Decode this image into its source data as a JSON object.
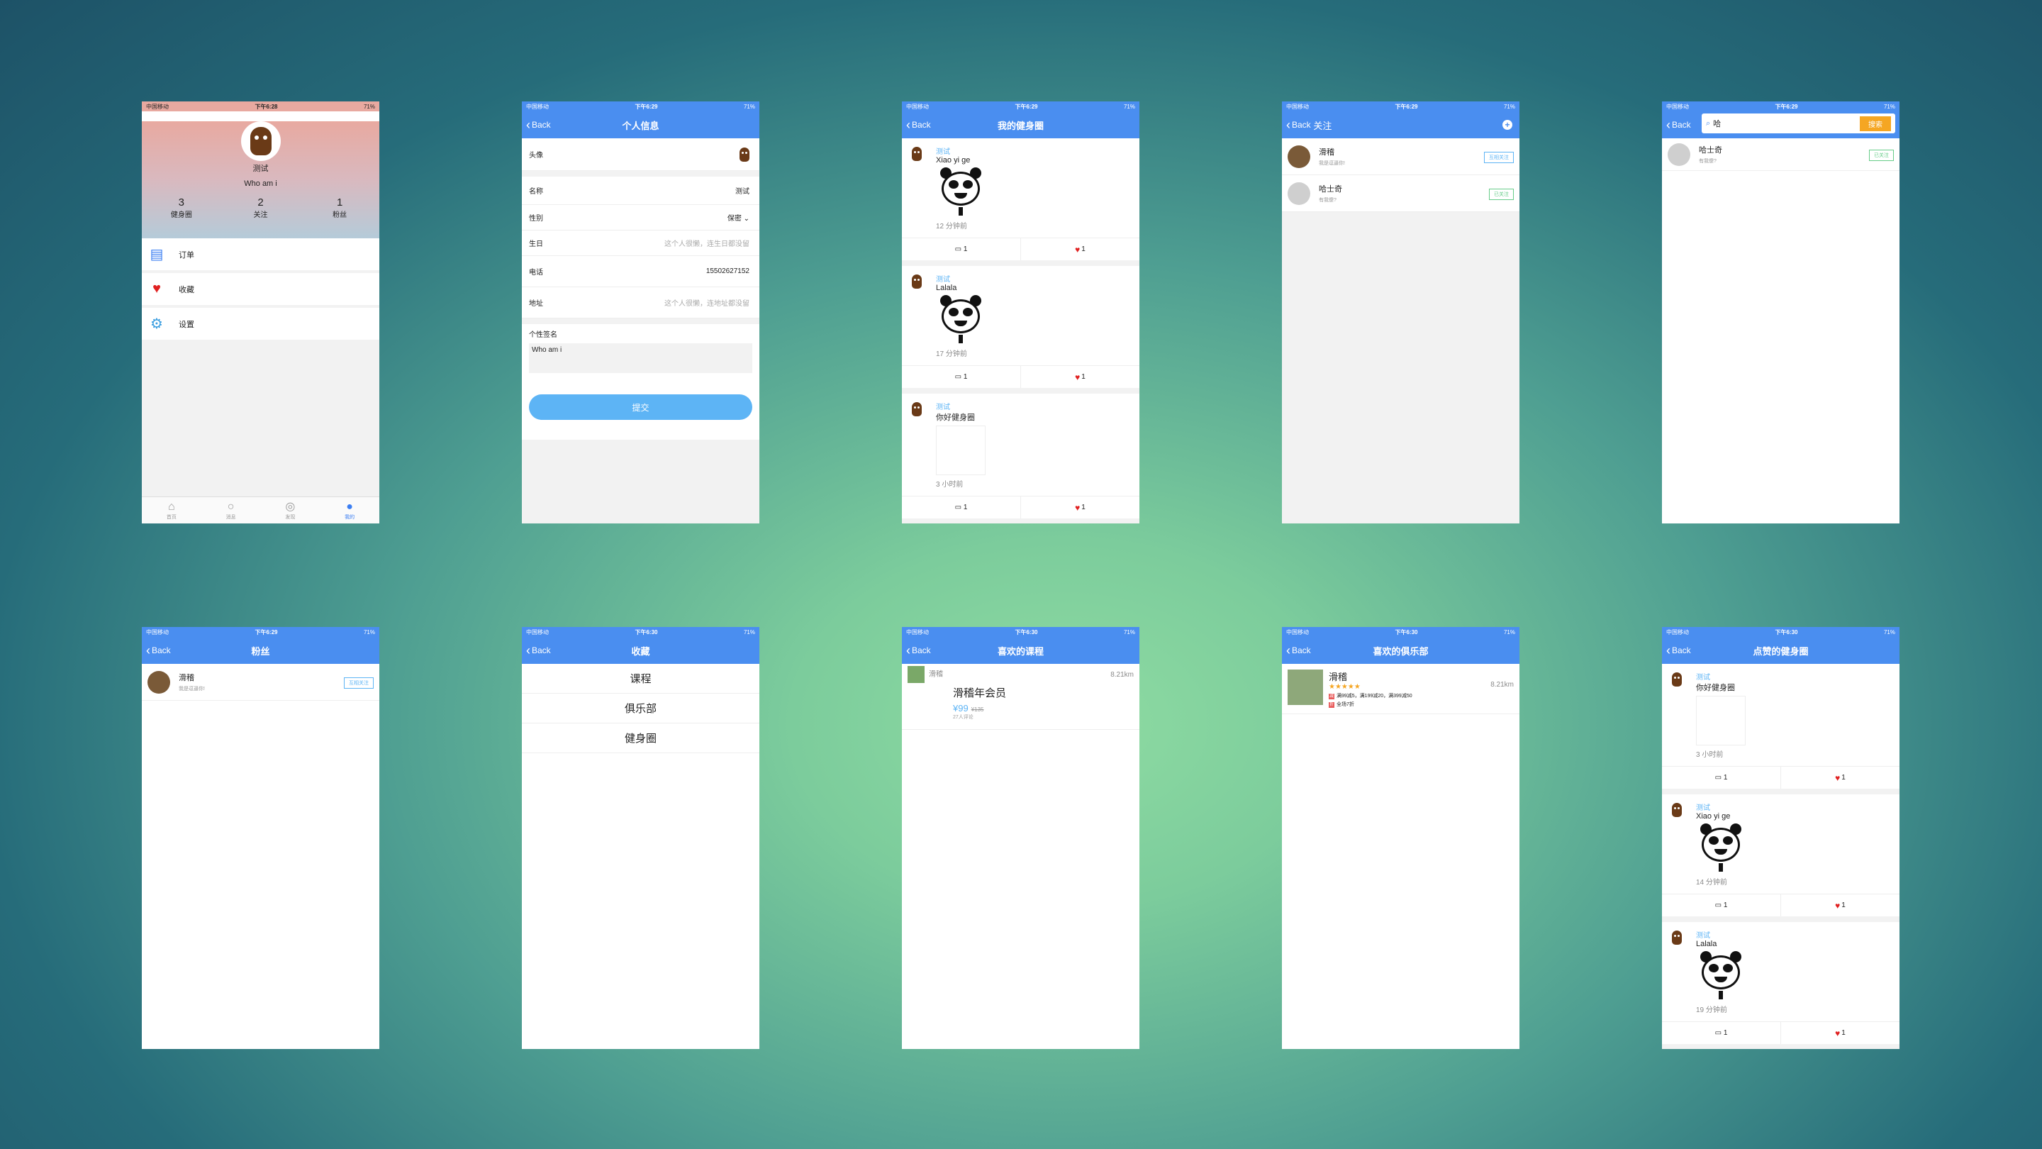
{
  "status": {
    "carrier": "中国移动",
    "battery": "71%",
    "times": [
      "下午6:28",
      "下午6:29",
      "下午6:29",
      "下午6:29",
      "下午6:29",
      "下午6:29",
      "下午6:30",
      "下午6:30",
      "下午6:30",
      "下午6:30"
    ]
  },
  "back": "Back",
  "p1": {
    "name": "测试",
    "signature": "Who am i",
    "stats": [
      {
        "n": "3",
        "l": "健身圈"
      },
      {
        "n": "2",
        "l": "关注"
      },
      {
        "n": "1",
        "l": "粉丝"
      }
    ],
    "menu": [
      "订单",
      "收藏",
      "设置"
    ],
    "tabs": [
      "首页",
      "消息",
      "发现",
      "我的"
    ]
  },
  "p2": {
    "title": "个人信息",
    "avatar_label": "头像",
    "name_label": "名称",
    "name_value": "测试",
    "gender_label": "性别",
    "gender_value": "保密",
    "birthday_label": "生日",
    "birthday_ph": "这个人很懒，连生日都没留",
    "phone_label": "电话",
    "phone_value": "15502627152",
    "address_label": "地址",
    "address_ph": "这个人很懒，连地址都没留",
    "sig_label": "个性签名",
    "sig_value": "Who am i",
    "submit": "提交"
  },
  "p3": {
    "title": "我的健身圈",
    "posts": [
      {
        "name": "测试",
        "content": "Xiao yi ge",
        "time": "12 分钟前",
        "comments": "1",
        "likes": "1"
      },
      {
        "name": "测试",
        "content": "Lalala",
        "time": "17 分钟前",
        "comments": "1",
        "likes": "1"
      },
      {
        "name": "测试",
        "content": "你好健身圈",
        "time": "3 小时前",
        "comments": "1",
        "likes": "1"
      }
    ]
  },
  "p4": {
    "title": "关注",
    "rows": [
      {
        "name": "滑稽",
        "sub": "我是逗逼你!",
        "btn": "互相关注"
      },
      {
        "name": "哈士奇",
        "sub": "有我傻?",
        "btn": "已关注"
      }
    ]
  },
  "p5": {
    "search": "哈",
    "search_btn": "搜索",
    "rows": [
      {
        "name": "哈士奇",
        "sub": "有我傻?",
        "btn": "已关注"
      }
    ]
  },
  "p6": {
    "title": "粉丝",
    "rows": [
      {
        "name": "滑稽",
        "sub": "我是逗逼你!",
        "btn": "互相关注"
      }
    ]
  },
  "p7": {
    "title": "收藏",
    "items": [
      "课程",
      "俱乐部",
      "健身圈"
    ]
  },
  "p8": {
    "title": "喜欢的课程",
    "org": "滑稽",
    "dist": "8.21km",
    "course": "滑稽年会员",
    "price": "¥99",
    "old_price": "¥135",
    "count": "27人评论"
  },
  "p9": {
    "title": "喜欢的俱乐部",
    "name": "滑稽",
    "stars": "★★★★★",
    "dist": "8.21km",
    "promo": "满99减5，满199减20，满399减50",
    "discount": "全场7折",
    "promo_tag": "减",
    "discount_tag": "折"
  },
  "p10": {
    "title": "点赞的健身圈",
    "posts": [
      {
        "name": "测试",
        "content": "你好健身圈",
        "time": "3 小时前",
        "comments": "1",
        "likes": "1"
      },
      {
        "name": "测试",
        "content": "Xiao yi ge",
        "time": "14 分钟前",
        "comments": "1",
        "likes": "1"
      },
      {
        "name": "测试",
        "content": "Lalala",
        "time": "19 分钟前",
        "comments": "1",
        "likes": "1"
      }
    ]
  }
}
